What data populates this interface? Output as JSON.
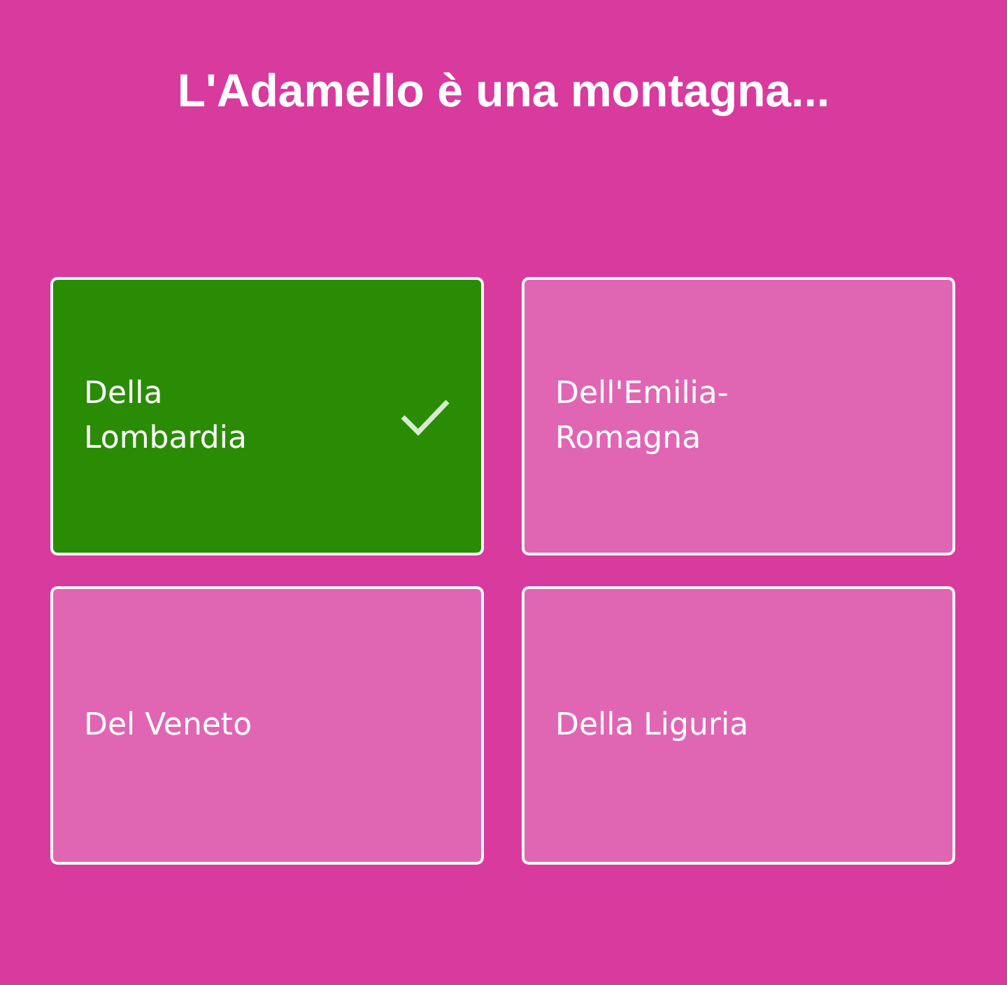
{
  "question": "L'Adamello è una montagna...",
  "answers": [
    {
      "label": "Della Lombardia",
      "selected": true
    },
    {
      "label": "Dell'Emilia-Romagna",
      "selected": false
    },
    {
      "label": "Del Veneto",
      "selected": false
    },
    {
      "label": "Della Liguria",
      "selected": false
    }
  ]
}
